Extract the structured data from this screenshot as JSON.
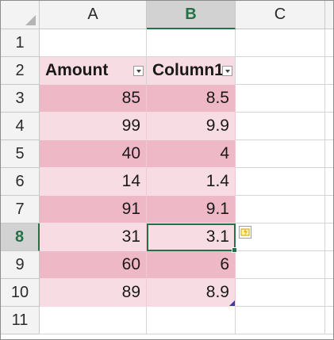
{
  "columns": [
    "A",
    "B",
    "C"
  ],
  "active_column": "B",
  "active_row": "8",
  "rows": [
    {
      "n": "1",
      "a": "",
      "b": ""
    },
    {
      "n": "2",
      "a": "Amount",
      "b": "Column1"
    },
    {
      "n": "3",
      "a": "85",
      "b": "8.5"
    },
    {
      "n": "4",
      "a": "99",
      "b": "9.9"
    },
    {
      "n": "5",
      "a": "40",
      "b": "4"
    },
    {
      "n": "6",
      "a": "14",
      "b": "1.4"
    },
    {
      "n": "7",
      "a": "91",
      "b": "9.1"
    },
    {
      "n": "8",
      "a": "31",
      "b": "3.1"
    },
    {
      "n": "9",
      "a": "60",
      "b": "6"
    },
    {
      "n": "10",
      "a": "89",
      "b": "8.9"
    },
    {
      "n": "11",
      "a": "",
      "b": ""
    }
  ],
  "colors": {
    "accent_green": "#217346",
    "table_band_dark": "#efb8c6",
    "table_band_light": "#f8dce4"
  },
  "icons": {
    "filter": "chevron-down-icon",
    "quick_analysis": "quick-analysis-icon"
  }
}
